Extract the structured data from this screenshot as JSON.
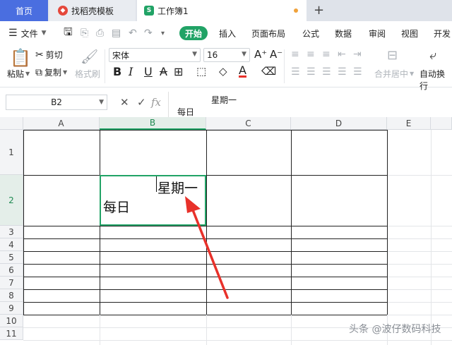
{
  "tabs": {
    "home": "首页",
    "template": "找稻壳模板",
    "workbook": "工作簿1",
    "new_tab": "+"
  },
  "menu": {
    "file": "文件",
    "start": "开始",
    "insert": "插入",
    "page_layout": "页面布局",
    "formula": "公式",
    "data": "数据",
    "review": "审阅",
    "view": "视图",
    "developer": "开发"
  },
  "ribbon": {
    "cut": "剪切",
    "paste": "粘贴",
    "copy": "复制",
    "format_painter": "格式刷",
    "font_name": "宋体",
    "font_size": "16",
    "merge_center": "合并居中",
    "wrap_text": "自动换行"
  },
  "formula_bar": {
    "name_box": "B2",
    "content_line1": "星期一",
    "content_line2": "每日"
  },
  "grid": {
    "columns": [
      "A",
      "B",
      "C",
      "D",
      "E"
    ],
    "rows": [
      "1",
      "2",
      "3",
      "4",
      "5",
      "6",
      "7",
      "8",
      "9",
      "10",
      "11"
    ],
    "selected_cell": "B2",
    "cell_b2_line1": "星期一",
    "cell_b2_line2": "每日"
  },
  "watermark": "头条 @波仔数码科技",
  "colors": {
    "accent_green": "#21a366",
    "home_tab_blue": "#4a6ee0",
    "arrow_red": "#e8312a"
  }
}
